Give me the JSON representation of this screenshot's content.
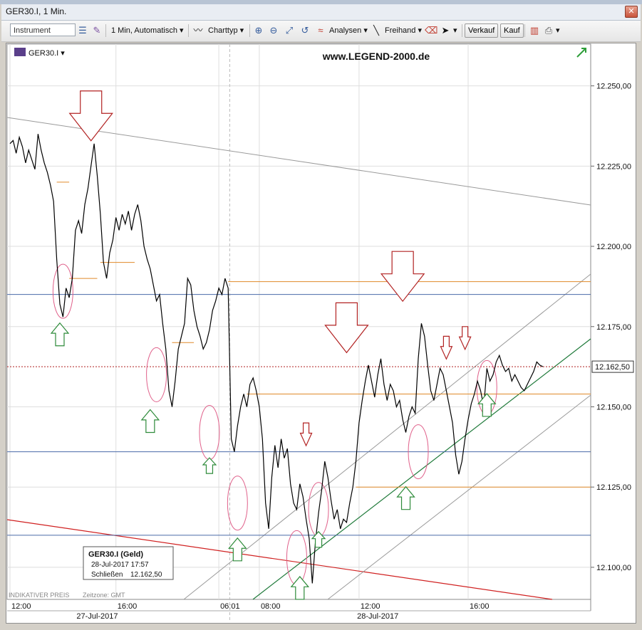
{
  "window": {
    "title": "GER30.I, 1 Min."
  },
  "toolbar": {
    "instrument_placeholder": "Instrument",
    "interval_label": "1 Min, Automatisch",
    "charttype_label": "Charttyp",
    "analysen_label": "Analysen",
    "freihand_label": "Freihand",
    "verkauf_label": "Verkauf",
    "kauf_label": "Kauf"
  },
  "chart_header": {
    "symbol": "GER30.I",
    "website": "www.LEGEND-2000.de",
    "footer_left": "INDIKATIVER PREIS",
    "footer_zone": "Zeitzone: GMT"
  },
  "info_box": {
    "title": "GER30.I (Geld)",
    "date": "28-Jul-2017 17:57",
    "close_label": "Schließen",
    "close_value": "12.162,50"
  },
  "colors": {
    "price": "#000000",
    "up_arrow": "#2e8b3a",
    "down_arrow": "#b22222",
    "orange_level": "#e08a2a",
    "blue_level": "#4a6aa8",
    "red_trend": "#d02020",
    "green_channel": "#1f7a3a",
    "ellipse": "#e0608a"
  },
  "chart_data": {
    "type": "line",
    "y_ticks": [
      "12.250,00",
      "12.225,00",
      "12.200,00",
      "12.175,00",
      "12.150,00",
      "12.125,00",
      "12.100,00"
    ],
    "y_tick_values": [
      12250,
      12225,
      12200,
      12175,
      12150,
      12125,
      12100
    ],
    "ylim": [
      12090,
      12263
    ],
    "x_ticks": [
      "12:00",
      "16:00",
      "06:01",
      "08:00",
      "12:00",
      "16:00"
    ],
    "date_labels": [
      "27-Jul-2017",
      "28-Jul-2017"
    ],
    "current_price": 12162.5,
    "current_price_label": "12.162,50",
    "series": [
      {
        "values": [
          [
            0,
            12232
          ],
          [
            1,
            12233
          ],
          [
            2,
            12229
          ],
          [
            3,
            12234
          ],
          [
            4,
            12231
          ],
          [
            5,
            12226
          ],
          [
            6,
            12230
          ],
          [
            7,
            12227
          ],
          [
            8,
            12224
          ],
          [
            9,
            12235
          ],
          [
            10,
            12230
          ],
          [
            11,
            12226
          ],
          [
            12,
            12223
          ],
          [
            13,
            12219
          ],
          [
            14,
            12214
          ],
          [
            15,
            12196
          ],
          [
            16,
            12182
          ],
          [
            17,
            12178
          ],
          [
            18,
            12187
          ],
          [
            19,
            12184
          ],
          [
            20,
            12190
          ],
          [
            21,
            12205
          ],
          [
            22,
            12208
          ],
          [
            23,
            12204
          ],
          [
            24,
            12213
          ],
          [
            25,
            12218
          ],
          [
            26,
            12225
          ],
          [
            27,
            12232
          ],
          [
            28,
            12222
          ],
          [
            29,
            12210
          ],
          [
            30,
            12195
          ],
          [
            31,
            12190
          ],
          [
            32,
            12198
          ],
          [
            33,
            12202
          ],
          [
            34,
            12209
          ],
          [
            35,
            12205
          ],
          [
            36,
            12210
          ],
          [
            37,
            12207
          ],
          [
            38,
            12211
          ],
          [
            39,
            12205
          ],
          [
            40,
            12210
          ],
          [
            41,
            12213
          ],
          [
            42,
            12208
          ],
          [
            43,
            12200
          ],
          [
            44,
            12196
          ],
          [
            45,
            12193
          ],
          [
            46,
            12188
          ],
          [
            47,
            12183
          ],
          [
            48,
            12185
          ],
          [
            49,
            12176
          ],
          [
            50,
            12168
          ],
          [
            51,
            12155
          ],
          [
            52,
            12150
          ],
          [
            53,
            12158
          ],
          [
            54,
            12168
          ],
          [
            55,
            12172
          ],
          [
            56,
            12176
          ],
          [
            57,
            12190
          ],
          [
            58,
            12188
          ],
          [
            59,
            12180
          ],
          [
            60,
            12175
          ],
          [
            61,
            12172
          ],
          [
            62,
            12168
          ],
          [
            63,
            12170
          ],
          [
            64,
            12174
          ],
          [
            65,
            12180
          ],
          [
            66,
            12183
          ],
          [
            67,
            12187
          ],
          [
            68,
            12185
          ],
          [
            69,
            12190
          ],
          [
            70,
            12187
          ],
          [
            71,
            12140
          ],
          [
            72,
            12136
          ],
          [
            73,
            12144
          ],
          [
            74,
            12150
          ],
          [
            75,
            12154
          ],
          [
            76,
            12150
          ],
          [
            77,
            12157
          ],
          [
            78,
            12159
          ],
          [
            79,
            12155
          ],
          [
            80,
            12150
          ],
          [
            81,
            12140
          ],
          [
            82,
            12120
          ],
          [
            83,
            12112
          ],
          [
            84,
            12128
          ],
          [
            85,
            12138
          ],
          [
            86,
            12131
          ],
          [
            87,
            12140
          ],
          [
            88,
            12134
          ],
          [
            89,
            12137
          ],
          [
            90,
            12126
          ],
          [
            91,
            12120
          ],
          [
            92,
            12118
          ],
          [
            93,
            12126
          ],
          [
            94,
            12122
          ],
          [
            95,
            12115
          ],
          [
            96,
            12109
          ],
          [
            97,
            12095
          ],
          [
            98,
            12108
          ],
          [
            99,
            12117
          ],
          [
            100,
            12124
          ],
          [
            101,
            12133
          ],
          [
            102,
            12128
          ],
          [
            103,
            12121
          ],
          [
            104,
            12115
          ],
          [
            105,
            12118
          ],
          [
            106,
            12112
          ],
          [
            107,
            12115
          ],
          [
            108,
            12114
          ],
          [
            109,
            12120
          ],
          [
            110,
            12125
          ],
          [
            111,
            12133
          ],
          [
            112,
            12145
          ],
          [
            113,
            12152
          ],
          [
            114,
            12158
          ],
          [
            115,
            12163
          ],
          [
            116,
            12158
          ],
          [
            117,
            12153
          ],
          [
            118,
            12160
          ],
          [
            119,
            12165
          ],
          [
            120,
            12157
          ],
          [
            121,
            12152
          ],
          [
            122,
            12157
          ],
          [
            123,
            12155
          ],
          [
            124,
            12150
          ],
          [
            125,
            12152
          ],
          [
            126,
            12146
          ],
          [
            127,
            12142
          ],
          [
            128,
            12147
          ],
          [
            129,
            12150
          ],
          [
            130,
            12148
          ],
          [
            131,
            12165
          ],
          [
            132,
            12176
          ],
          [
            133,
            12172
          ],
          [
            134,
            12163
          ],
          [
            135,
            12155
          ],
          [
            136,
            12152
          ],
          [
            137,
            12157
          ],
          [
            138,
            12162
          ],
          [
            139,
            12160
          ],
          [
            140,
            12155
          ],
          [
            141,
            12150
          ],
          [
            142,
            12145
          ],
          [
            143,
            12135
          ],
          [
            144,
            12129
          ],
          [
            145,
            12133
          ],
          [
            146,
            12140
          ],
          [
            147,
            12146
          ],
          [
            148,
            12151
          ],
          [
            149,
            12154
          ],
          [
            150,
            12158
          ],
          [
            151,
            12155
          ],
          [
            152,
            12150
          ],
          [
            153,
            12162
          ],
          [
            154,
            12158
          ],
          [
            155,
            12160
          ],
          [
            156,
            12164
          ],
          [
            157,
            12166
          ],
          [
            158,
            12163
          ],
          [
            159,
            12161
          ],
          [
            160,
            12162
          ],
          [
            161,
            12158
          ],
          [
            162,
            12160
          ],
          [
            163,
            12158
          ],
          [
            164,
            12156
          ],
          [
            165,
            12155
          ],
          [
            166,
            12157
          ],
          [
            167,
            12159
          ],
          [
            168,
            12161
          ],
          [
            169,
            12164
          ],
          [
            170,
            12163
          ],
          [
            171,
            12162.5
          ]
        ]
      }
    ],
    "levels": {
      "blue": [
        12185,
        12136,
        12110
      ],
      "orange": [
        12189,
        12154,
        12125
      ],
      "orange_short": [
        12220,
        12190,
        12195,
        12170
      ],
      "price_line": 12162.5
    },
    "annotations": {
      "down_arrows_large": [
        [
          26,
          12232
        ],
        [
          108,
          12166
        ],
        [
          126,
          12182
        ]
      ],
      "down_arrows_small": [
        [
          95,
          12137
        ],
        [
          140,
          12164
        ],
        [
          146,
          12167
        ]
      ],
      "up_arrows_large": [
        [
          16,
          12177
        ],
        [
          45,
          12150
        ],
        [
          73,
          12110
        ],
        [
          93,
          12098
        ],
        [
          127,
          12126
        ],
        [
          153,
          12155
        ]
      ],
      "up_arrows_small": [
        [
          64,
          12135
        ],
        [
          99,
          12112
        ]
      ],
      "ellipses": [
        [
          17,
          12186
        ],
        [
          47,
          12160
        ],
        [
          64,
          12142
        ],
        [
          73,
          12120
        ],
        [
          92,
          12103
        ],
        [
          99,
          12118
        ],
        [
          131,
          12136
        ],
        [
          153,
          12156
        ]
      ]
    }
  }
}
